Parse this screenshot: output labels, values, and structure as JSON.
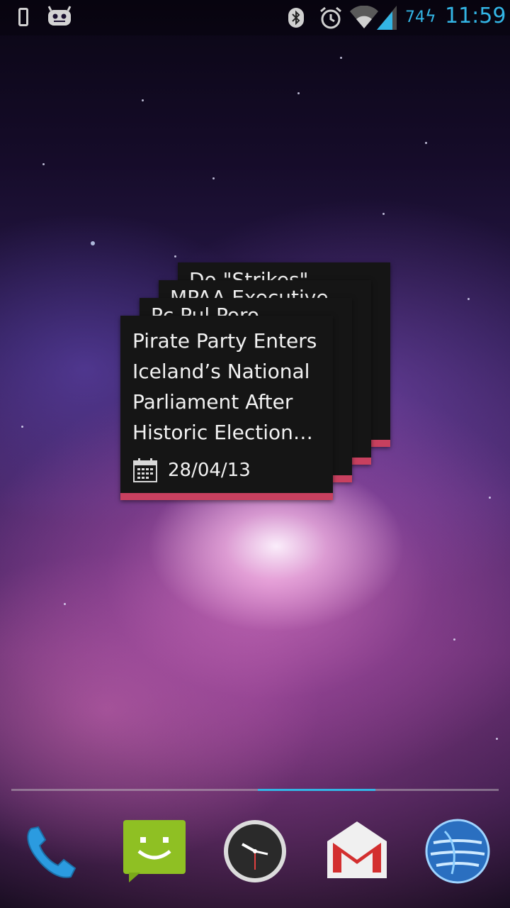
{
  "status_bar": {
    "battery_level": "74",
    "time": "11:59",
    "icons": [
      "phone-notification-icon",
      "cyanogenmod-robot-icon",
      "bluetooth-icon",
      "alarm-icon",
      "wifi-icon",
      "cell-signal-icon",
      "battery-charging-icon"
    ]
  },
  "widget": {
    "stack": [
      {
        "title": "Pirate Party Enters Iceland’s National Parliament After Historic Election…",
        "date": "28/04/13"
      },
      {
        "title": "Do \"Strikes\""
      },
      {
        "title": "MPAA Executive"
      },
      {
        "title": "Pc Pul Poro"
      }
    ]
  },
  "dock": {
    "apps": [
      "phone-icon",
      "messaging-icon",
      "clock-icon",
      "gmail-icon",
      "browser-globe-icon"
    ]
  },
  "colors": {
    "accent": "#33b5e5",
    "widget_bar": "#c8405f",
    "widget_bg": "#151515"
  }
}
